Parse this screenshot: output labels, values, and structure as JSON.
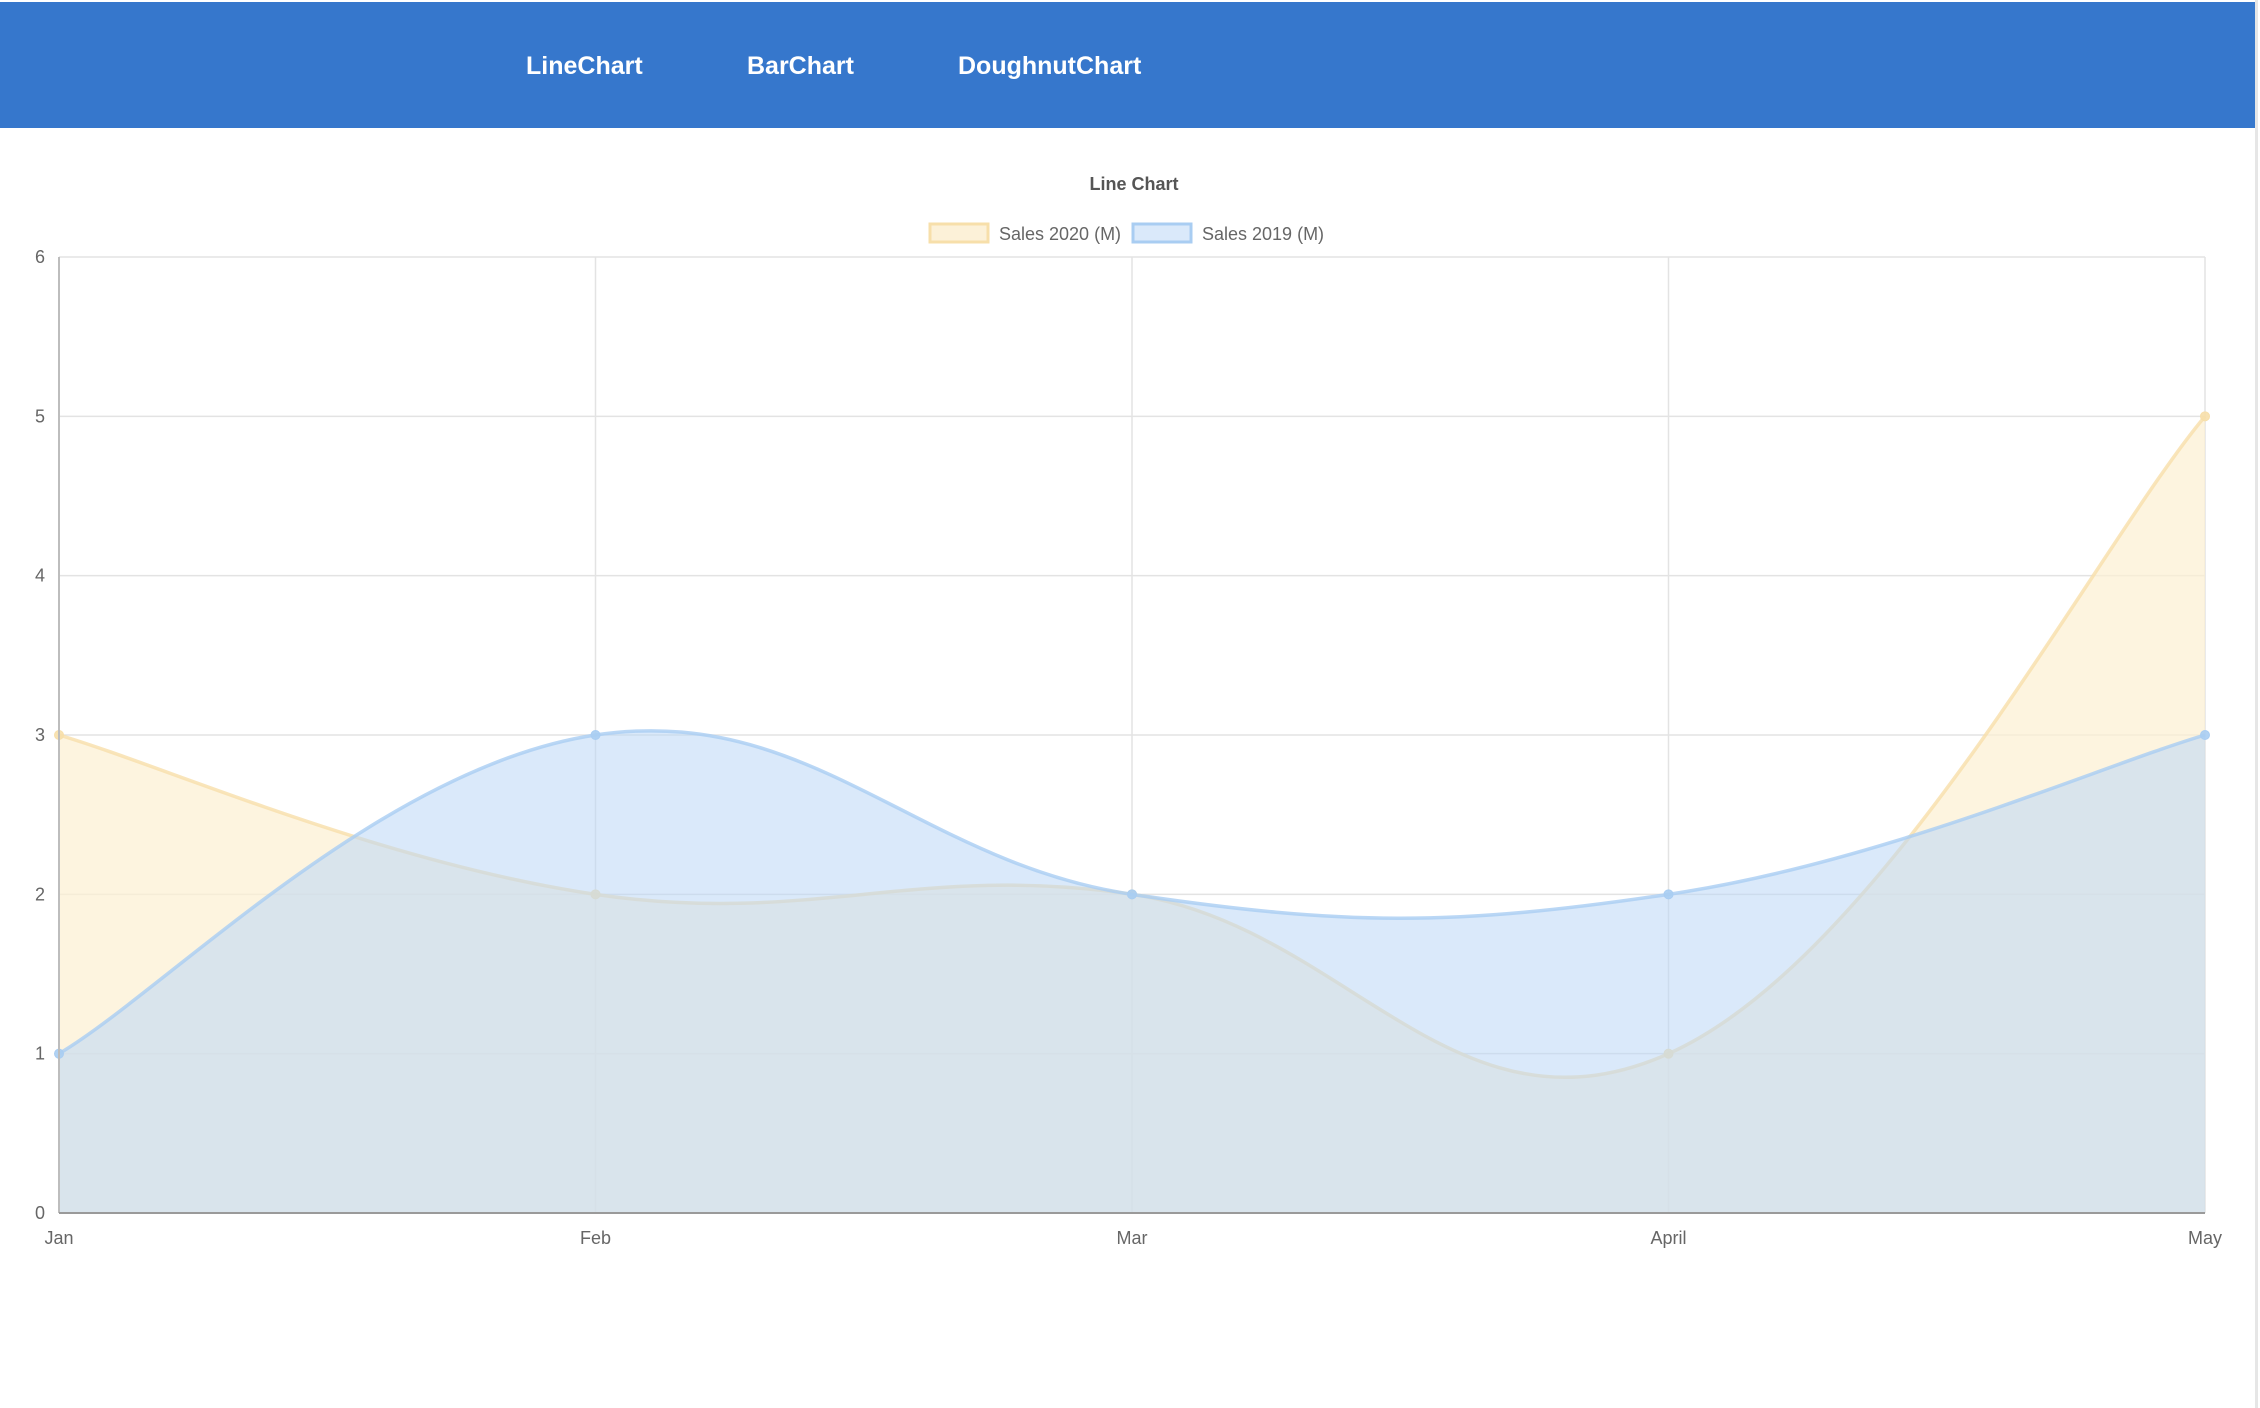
{
  "nav": {
    "items": [
      {
        "label": "LineChart"
      },
      {
        "label": "BarChart"
      },
      {
        "label": "DoughnutChart"
      }
    ]
  },
  "colors": {
    "header": "#3677cc",
    "series_2020_fill": "#fcefd1",
    "series_2020_border": "#f7dfaa",
    "series_2019_fill": "#bcd7f5",
    "series_2019_border": "#a9cdf2"
  },
  "chart_data": {
    "type": "area",
    "title": "Line Chart",
    "categories": [
      "Jan",
      "Feb",
      "Mar",
      "April",
      "May"
    ],
    "series": [
      {
        "name": "Sales 2020 (M)",
        "values": [
          3,
          2,
          2,
          1,
          5
        ]
      },
      {
        "name": "Sales 2019 (M)",
        "values": [
          1,
          3,
          2,
          2,
          3
        ]
      }
    ],
    "ylim": [
      0,
      6
    ],
    "yticks": [
      0,
      1,
      2,
      3,
      4,
      5,
      6
    ],
    "grid": true,
    "legend": "top-center"
  }
}
